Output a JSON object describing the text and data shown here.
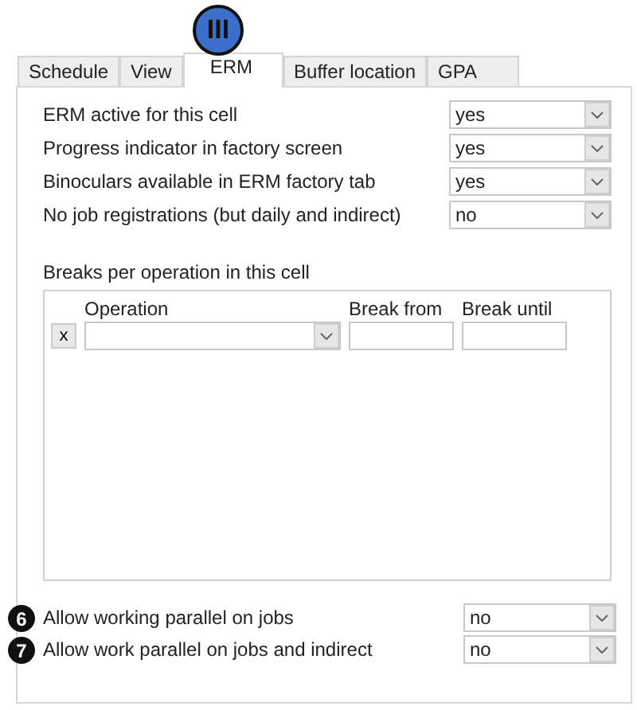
{
  "callout": {
    "label": "III"
  },
  "tabs": [
    {
      "label": "Schedule",
      "selected": false
    },
    {
      "label": "View",
      "selected": false
    },
    {
      "label": "ERM",
      "selected": true
    },
    {
      "label": "Buffer location",
      "selected": false
    },
    {
      "label": "GPA",
      "selected": false
    }
  ],
  "settings": [
    {
      "label": "ERM active for this cell",
      "value": "yes"
    },
    {
      "label": "Progress indicator in factory screen",
      "value": "yes"
    },
    {
      "label": "Binoculars available in ERM factory tab",
      "value": "yes"
    },
    {
      "label": "No job registrations (but daily and indirect)",
      "value": "no"
    }
  ],
  "breaks": {
    "title": "Breaks per operation in this cell",
    "columns": [
      "Operation",
      "Break from",
      "Break until"
    ],
    "rows": [
      {
        "delete": "x"
      }
    ]
  },
  "parallel_settings": [
    {
      "badge": "6",
      "label": "Allow working parallel on jobs",
      "value": "no"
    },
    {
      "badge": "7",
      "label": "Allow work parallel on jobs and indirect",
      "value": "no"
    }
  ]
}
